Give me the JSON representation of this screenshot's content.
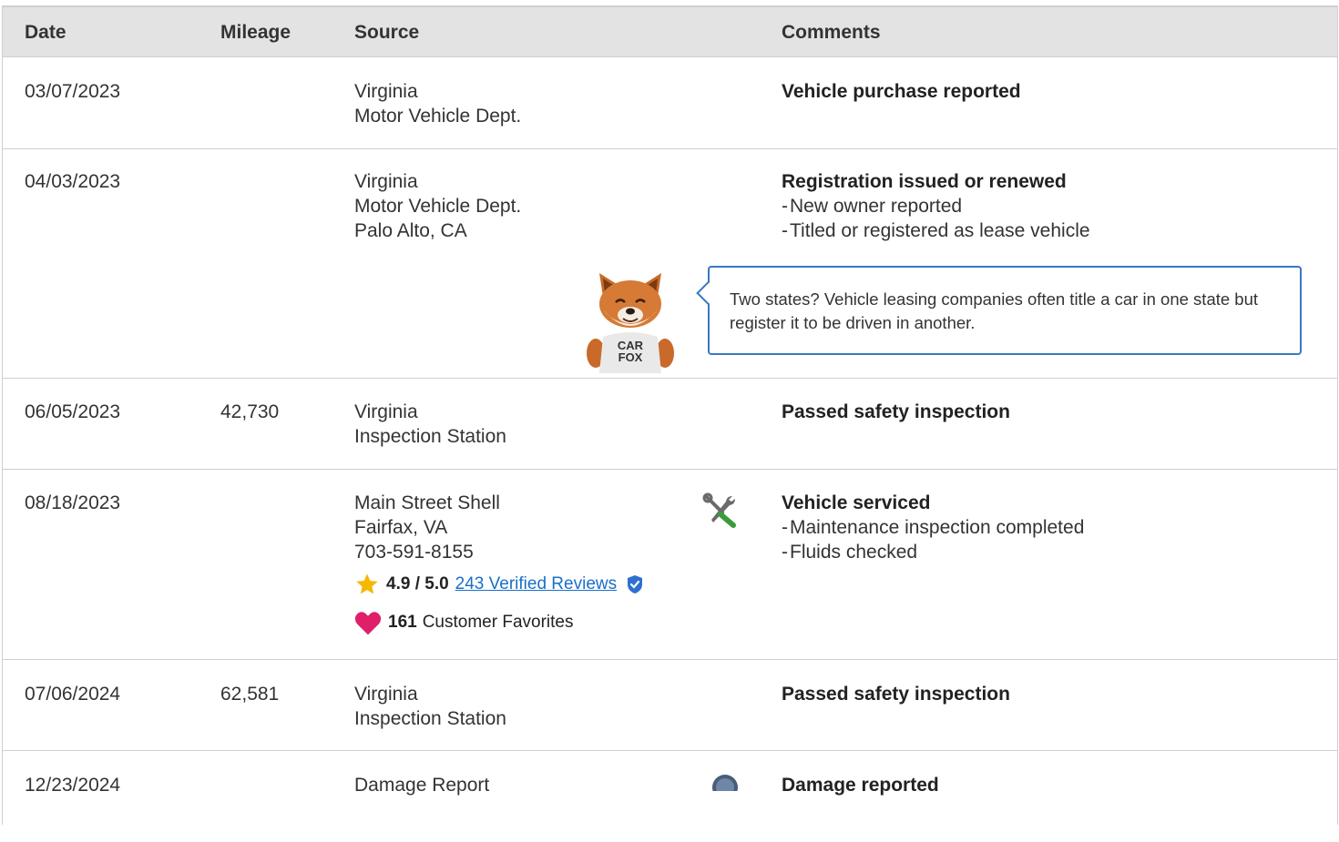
{
  "headers": {
    "date": "Date",
    "mileage": "Mileage",
    "source": "Source",
    "comments": "Comments"
  },
  "rows": [
    {
      "date": "03/07/2023",
      "mileage": "",
      "source": [
        "Virginia",
        "Motor Vehicle Dept."
      ],
      "comment_title": "Vehicle purchase reported",
      "comment_items": []
    },
    {
      "date": "04/03/2023",
      "mileage": "",
      "source": [
        "Virginia",
        "Motor Vehicle Dept.",
        "Palo Alto, CA"
      ],
      "comment_title": "Registration issued or renewed",
      "comment_items": [
        "New owner reported",
        "Titled or registered as lease vehicle"
      ],
      "tooltip": "Two states? Vehicle leasing companies often title a car in one state but register it to be driven in another.",
      "mascot_text": [
        "CAR",
        "FOX"
      ]
    },
    {
      "date": "06/05/2023",
      "mileage": "42,730",
      "source": [
        "Virginia",
        "Inspection Station"
      ],
      "comment_title": "Passed safety inspection",
      "comment_items": []
    },
    {
      "date": "08/18/2023",
      "mileage": "",
      "source": [
        "Main Street Shell",
        "Fairfax, VA",
        "703-591-8155"
      ],
      "comment_title": "Vehicle serviced",
      "comment_items": [
        "Maintenance inspection completed",
        "Fluids checked"
      ],
      "rating": "4.9 / 5.0",
      "reviews_link": "243 Verified Reviews",
      "favorites_count": "161",
      "favorites_label": "Customer Favorites",
      "icon": "service-wrench-icon"
    },
    {
      "date": "07/06/2024",
      "mileage": "62,581",
      "source": [
        "Virginia",
        "Inspection Station"
      ],
      "comment_title": "Passed safety inspection",
      "comment_items": []
    },
    {
      "date": "12/23/2024",
      "mileage": "",
      "source": [
        "Damage Report"
      ],
      "comment_title": "Damage reported",
      "comment_items": [],
      "icon": "damage-icon"
    }
  ],
  "colors": {
    "header_bg": "#e3e3e3",
    "border": "#cfcfcf",
    "tooltip_border": "#3a77c4",
    "link": "#1a6fc9",
    "star": "#f5b800",
    "heart": "#e01f6b",
    "verified": "#2f6fd1"
  }
}
